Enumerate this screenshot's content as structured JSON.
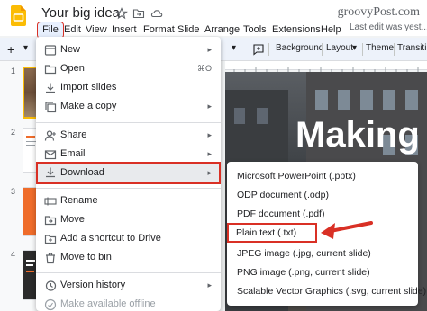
{
  "header": {
    "title": "Your big idea",
    "watermark": "groovyPost.com"
  },
  "menubar": {
    "items": [
      "File",
      "Edit",
      "View",
      "Insert",
      "Format",
      "Slide",
      "Arrange",
      "Tools",
      "Extensions",
      "Help"
    ],
    "last_edit": "Last edit was yest..."
  },
  "toolbar": {
    "plus": "+",
    "background": "Background",
    "layout": "Layout",
    "theme": "Theme",
    "transition": "Transiti"
  },
  "filmstrip": {
    "slide_numbers": [
      "1",
      "2",
      "3",
      "4"
    ]
  },
  "canvas": {
    "title": "Making"
  },
  "file_menu": {
    "items": [
      {
        "label": "New",
        "icon": "new-doc-icon",
        "right": "▸"
      },
      {
        "label": "Open",
        "icon": "folder-icon",
        "right": "⌘O"
      },
      {
        "label": "Import slides",
        "icon": "import-icon",
        "right": ""
      },
      {
        "label": "Make a copy",
        "icon": "copy-icon",
        "right": "▸"
      },
      {
        "label": "Share",
        "icon": "share-person-icon",
        "right": "▸"
      },
      {
        "label": "Email",
        "icon": "email-icon",
        "right": "▸"
      },
      {
        "label": "Download",
        "icon": "download-icon",
        "right": "▸"
      },
      {
        "label": "Rename",
        "icon": "rename-icon",
        "right": ""
      },
      {
        "label": "Move",
        "icon": "move-icon",
        "right": ""
      },
      {
        "label": "Add a shortcut to Drive",
        "icon": "drive-shortcut-icon",
        "right": ""
      },
      {
        "label": "Move to bin",
        "icon": "trash-icon",
        "right": ""
      },
      {
        "label": "Version history",
        "icon": "history-icon",
        "right": "▸"
      },
      {
        "label": "Make available offline",
        "icon": "offline-icon",
        "right": ""
      }
    ]
  },
  "download_menu": {
    "items": [
      "Microsoft PowerPoint (.pptx)",
      "ODP document (.odp)",
      "PDF document (.pdf)",
      "Plain text (.txt)",
      "JPEG image (.jpg, current slide)",
      "PNG image (.png, current slide)",
      "Scalable Vector Graphics (.svg, current slide)"
    ]
  },
  "colors": {
    "highlight": "#d93025",
    "menu_active_bg": "#e8f0fe",
    "logo_yellow": "#fbbc04"
  }
}
